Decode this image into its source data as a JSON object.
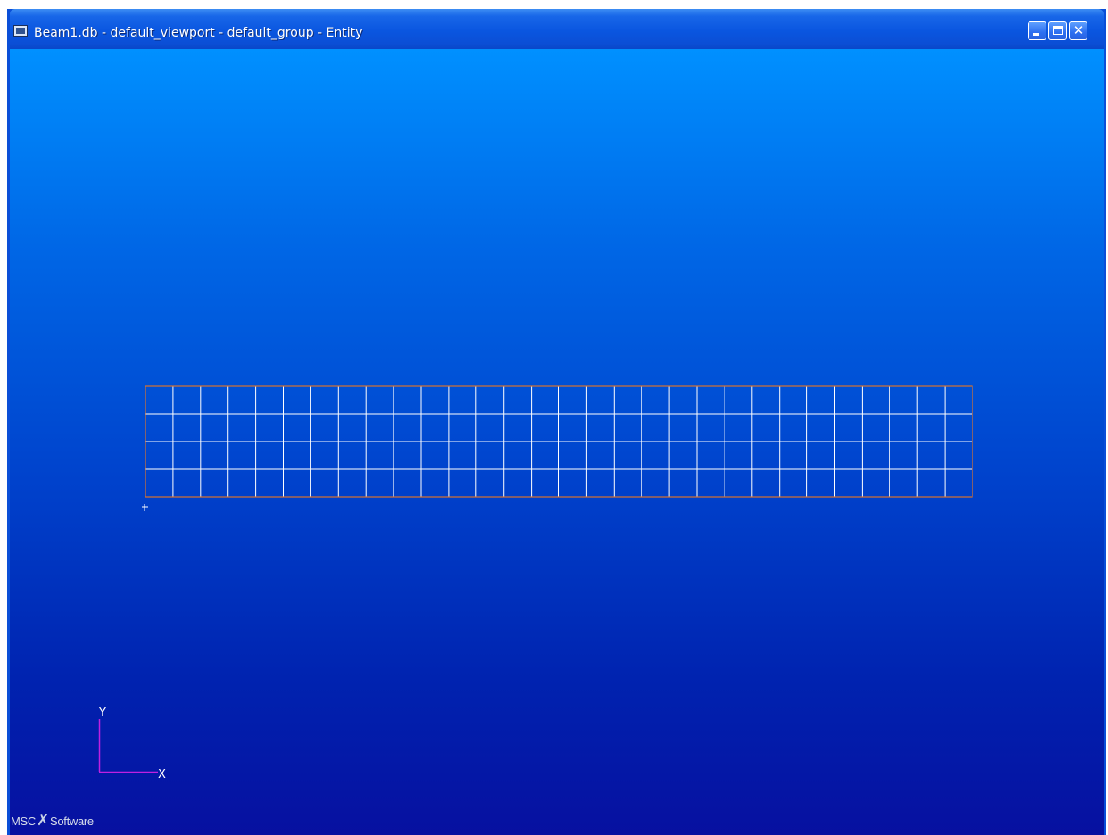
{
  "window": {
    "title": "Beam1.db - default_viewport - default_group - Entity",
    "controls": {
      "minimize": "minimize-icon",
      "maximize": "maximize-icon",
      "close": "close-icon",
      "close_glyph": "✕"
    }
  },
  "viewport": {
    "background_top": "#0090ff",
    "background_bottom": "#0710a0",
    "mesh": {
      "columns": 30,
      "rows": 4,
      "edge_color": "#d9732e",
      "grid_color": "#ffffff"
    },
    "axes": {
      "x_label": "X",
      "y_label": "Y",
      "color": "#c020e0"
    },
    "logo": {
      "left_text": "MSC",
      "right_text": "Software"
    }
  }
}
